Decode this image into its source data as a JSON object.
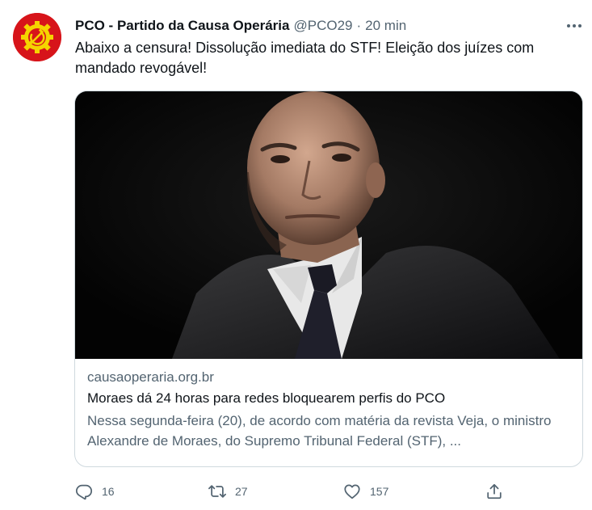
{
  "tweet": {
    "display_name": "PCO - Partido da Causa Operária",
    "handle": "@PCO29",
    "separator": "·",
    "time": "20 min",
    "text": "Abaixo a censura! Dissolução imediata do STF! Eleição dos juízes com mandado revogável!",
    "avatar_icon": "hammer-sickle-gear-icon"
  },
  "card": {
    "domain": "causaoperaria.org.br",
    "title": "Moraes dá 24 horas para redes bloquearem perfis do PCO",
    "description": "Nessa segunda-feira (20), de acordo com matéria da revista Veja, o ministro Alexandre de Moraes, do Supremo Tribunal Federal (STF), ..."
  },
  "actions": {
    "reply_count": "16",
    "retweet_count": "27",
    "like_count": "157",
    "reply_icon": "reply-icon",
    "retweet_icon": "retweet-icon",
    "like_icon": "heart-icon",
    "share_icon": "share-icon"
  },
  "colors": {
    "text_primary": "#0f1419",
    "text_secondary": "#536471",
    "border": "#cfd9de",
    "avatar_red": "#d7141a",
    "avatar_yellow": "#f5d400"
  }
}
